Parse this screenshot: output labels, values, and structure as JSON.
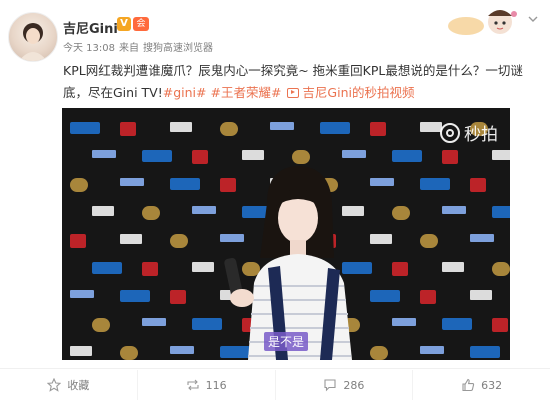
{
  "post": {
    "username": "吉尼Gini",
    "verified_badge": "V",
    "vip_badge": "会",
    "time": "今天 13:08",
    "source_prefix": "来自",
    "source": "搜狗高速浏览器",
    "text_main": "KPL网红裁判遭谁魔爪？辰鬼内心一探究竟~ 拖米重回KPL最想说的是什么？一切谜底，尽在Gini TV!",
    "topic_1": "#gini#",
    "topic_2": "#王者荣耀#",
    "video_link": "吉尼Gini的秒拍视频"
  },
  "video": {
    "watermark": "秒拍",
    "subtitle": "是不是"
  },
  "actions": {
    "collect_label": "收藏",
    "repost_count": "116",
    "comment_count": "286",
    "like_count": "632"
  },
  "colors": {
    "link": "#eb7350",
    "meta": "#808080"
  }
}
